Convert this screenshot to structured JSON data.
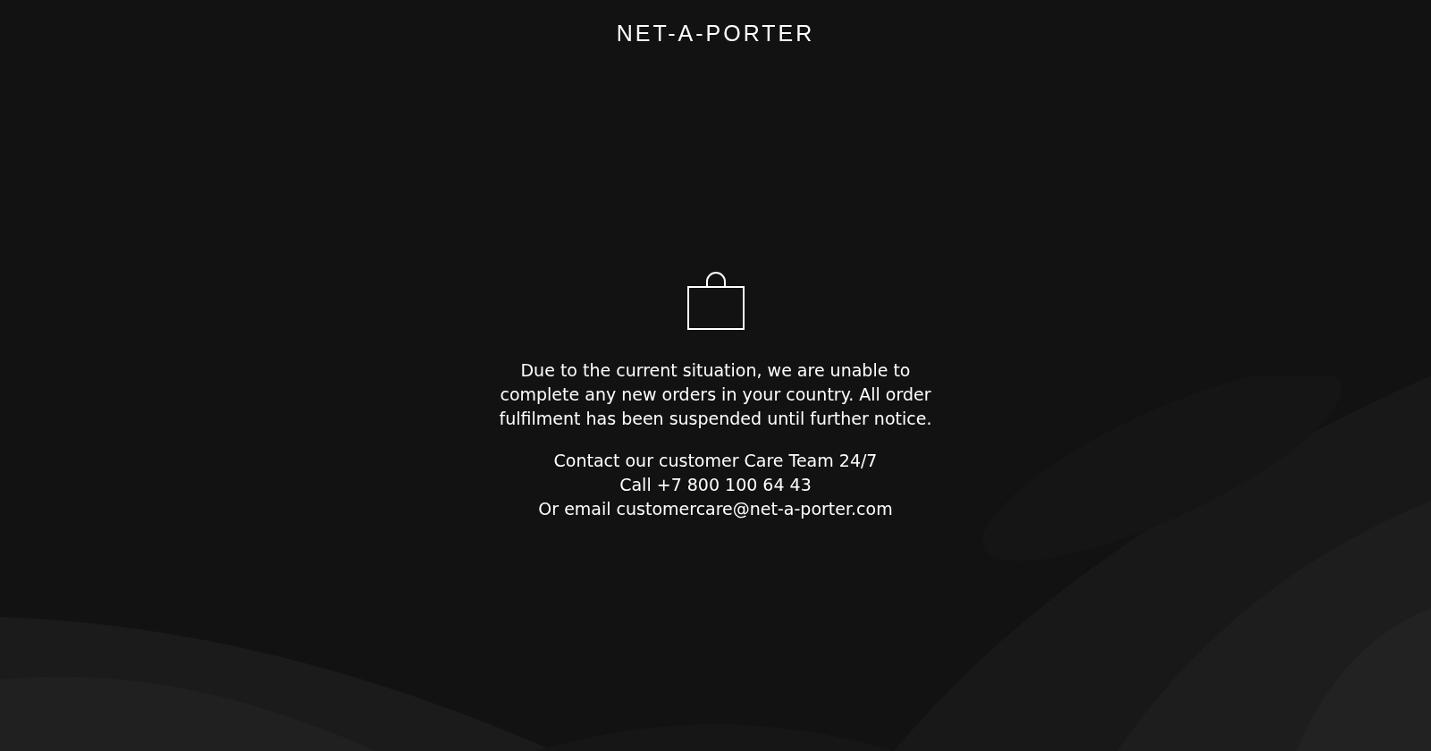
{
  "header": {
    "logo": "NET-A-PORTER"
  },
  "notice": {
    "message": "Due to the current situation, we are unable to complete any new orders in your country. All order fulfilment has been suspended until further notice.",
    "contact_lines": [
      "Contact our customer Care Team 24/7",
      "Call +7 800 100 64 43",
      "Or email customercare@net-a-porter.com"
    ]
  }
}
